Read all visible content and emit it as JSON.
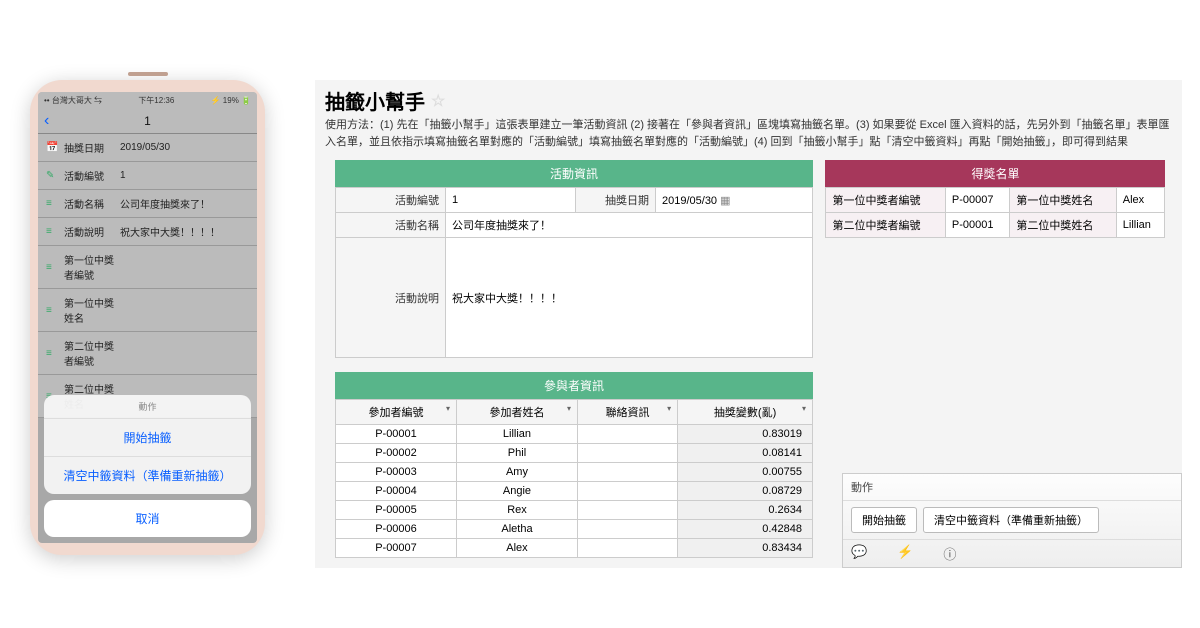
{
  "phone": {
    "statusbar": {
      "carrier": "•• 台灣大哥大 ⇆",
      "time": "下午12:36",
      "battery": "⚡ 19% 🔋"
    },
    "nav": {
      "back": "‹",
      "title": "1"
    },
    "rows": [
      {
        "icon": "📅",
        "label": "抽獎日期",
        "value": "2019/05/30"
      },
      {
        "icon": "✎",
        "label": "活動編號",
        "value": "1"
      },
      {
        "icon": "≡",
        "label": "活動名稱",
        "value": "公司年度抽獎來了！"
      },
      {
        "icon": "≡",
        "label": "活動說明",
        "value": "祝大家中大獎！！！！"
      },
      {
        "icon": "≡",
        "label": "第一位中獎者編號",
        "value": ""
      },
      {
        "icon": "≡",
        "label": "第一位中獎姓名",
        "value": ""
      },
      {
        "icon": "≡",
        "label": "第二位中獎者編號",
        "value": ""
      },
      {
        "icon": "≡",
        "label": "第二位中獎姓名",
        "value": ""
      }
    ],
    "sheet": {
      "header": "動作",
      "opts": [
        "開始抽籤",
        "清空中籤資料（準備重新抽籤）"
      ],
      "cancel": "取消"
    }
  },
  "desktop": {
    "title": "抽籤小幫手",
    "instructions": "使用方法：(1) 先在「抽籤小幫手」這張表單建立一筆活動資訊 (2) 接著在「參與者資訊」區塊填寫抽籤名單。(3) 如果要從 Excel 匯入資料的話，先另外到「抽籤名單」表單匯入名單，並且依指示填寫抽籤名單對應的「活動編號」填寫抽籤名單對應的「活動編號」(4) 回到「抽籤小幫手」點「清空中籤資料」再點「開始抽籤」，即可得到結果",
    "activity": {
      "header": "活動資訊",
      "id_label": "活動編號",
      "id_value": "1",
      "date_label": "抽獎日期",
      "date_value": "2019/05/30",
      "name_label": "活動名稱",
      "name_value": "公司年度抽獎來了！",
      "desc_label": "活動說明",
      "desc_value": "祝大家中大獎！！！！"
    },
    "winners": {
      "header": "得獎名單",
      "rows": [
        {
          "id_label": "第一位中獎者編號",
          "id_value": "P-00007",
          "name_label": "第一位中獎姓名",
          "name_value": "Alex"
        },
        {
          "id_label": "第二位中獎者編號",
          "id_value": "P-00001",
          "name_label": "第二位中獎姓名",
          "name_value": "Lillian"
        }
      ]
    },
    "participants": {
      "header": "參與者資訊",
      "cols": [
        "參加者編號",
        "參加者姓名",
        "聯絡資訊",
        "抽獎變數(亂)"
      ],
      "rows": [
        {
          "id": "P-00001",
          "name": "Lillian",
          "contact": "",
          "rand": "0.83019"
        },
        {
          "id": "P-00002",
          "name": "Phil",
          "contact": "",
          "rand": "0.08141"
        },
        {
          "id": "P-00003",
          "name": "Amy",
          "contact": "",
          "rand": "0.00755"
        },
        {
          "id": "P-00004",
          "name": "Angie",
          "contact": "",
          "rand": "0.08729"
        },
        {
          "id": "P-00005",
          "name": "Rex",
          "contact": "",
          "rand": "0.2634"
        },
        {
          "id": "P-00006",
          "name": "Aletha",
          "contact": "",
          "rand": "0.42848"
        },
        {
          "id": "P-00007",
          "name": "Alex",
          "contact": "",
          "rand": "0.83434"
        }
      ]
    },
    "actionbar": {
      "title": "動作",
      "btn1": "開始抽籤",
      "btn2": "清空中籤資料（準備重新抽籤）"
    }
  }
}
